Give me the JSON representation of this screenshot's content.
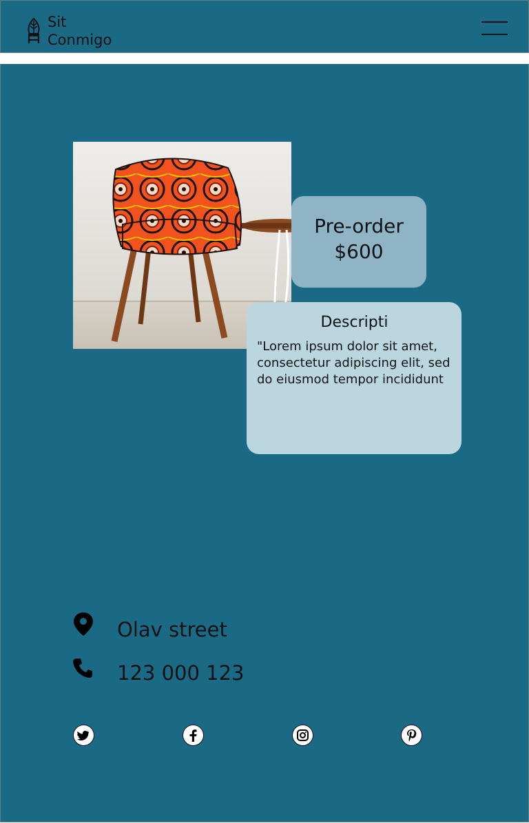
{
  "header": {
    "brand_line1": "Sit",
    "brand_line2": "Conmigo",
    "logo_icon": "chair-leaf-icon",
    "menu_icon": "hamburger-menu-icon"
  },
  "product": {
    "image_description_icon": "orange-patterned-chair-photo",
    "preorder_label": "Pre-order",
    "price": "$600",
    "description_title": "Descripti",
    "description_text": "\"Lorem ipsum dolor sit amet, consectetur adipiscing elit, sed do eiusmod tempor incididunt"
  },
  "contact": {
    "address": "Olav street",
    "address_icon": "map-pin-icon",
    "phone": "123 000 123",
    "phone_icon": "phone-icon"
  },
  "social": [
    {
      "icon": "twitter-icon"
    },
    {
      "icon": "facebook-icon"
    },
    {
      "icon": "instagram-icon"
    },
    {
      "icon": "pinterest-icon"
    }
  ],
  "colors": {
    "background_teal": "#1b6a85",
    "preorder_card": "#8fb4c6",
    "description_card": "#bcd6df",
    "chair_orange": "#f2521d"
  }
}
